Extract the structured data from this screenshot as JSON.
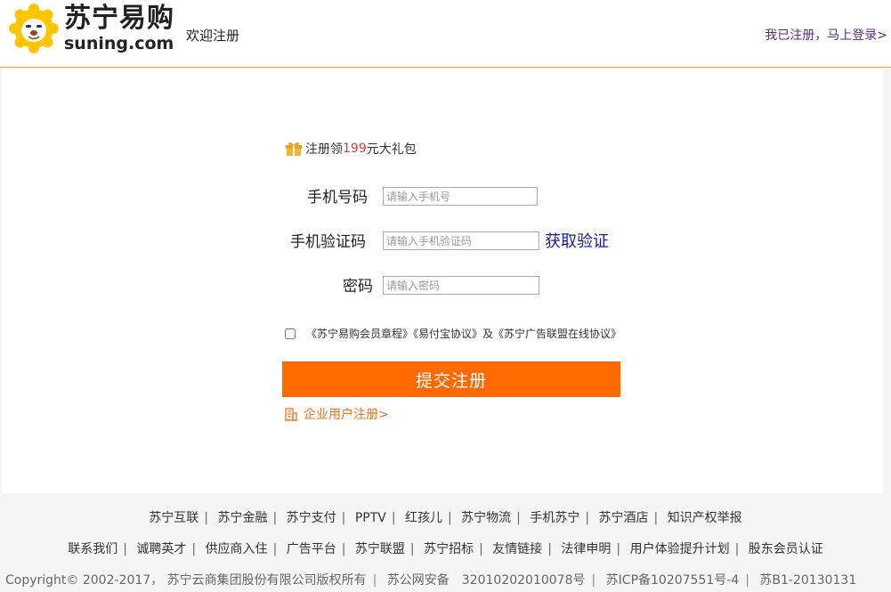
{
  "header": {
    "brand_cn": "苏宁易购",
    "brand_en": "suning.com",
    "welcome": "欢迎注册",
    "login_link": "我已注册，马上登录>"
  },
  "promo": {
    "prefix": "注册领 ",
    "amount": "199",
    "suffix": "元大礼包"
  },
  "form": {
    "phone_label": "手机号码",
    "phone_placeholder": "请输入手机号",
    "phone_value": "",
    "code_label": "手机验证码",
    "code_placeholder": "请输入手机验证码",
    "code_value": "",
    "get_code": "获取验证",
    "password_label": "密码",
    "password_placeholder": "请输入密码",
    "password_value": "",
    "agreement_checked": false,
    "agreement_text": "《苏宁易购会员章程》《易付宝协议》及《苏宁广告联盟在线协议》",
    "submit": "提交注册",
    "enterprise": "企业用户注册>"
  },
  "footer": {
    "row1": [
      "苏宁互联",
      "苏宁金融",
      "苏宁支付",
      "PPTV",
      "红孩儿",
      "苏宁物流",
      "手机苏宁",
      "苏宁酒店",
      "知识产权举报"
    ],
    "row2": [
      "联系我们",
      "诚聘英才",
      "供应商入住",
      "广告平台",
      "苏宁联盟",
      "苏宁招标",
      "友情链接",
      "法律申明",
      "用户体验提升计划",
      "股东会员认证"
    ],
    "copyright": "Copyright© 2002-2017， 苏宁云商集团股份有限公司版权所有",
    "police": "苏公网安备　32010202010078号",
    "icp": "苏ICP备10207551号-4",
    "b1": "苏B1-20130131"
  },
  "colors": {
    "accent_orange": "#ff6a00",
    "logo_yellow": "#ffc600",
    "promo_red": "#e4393c",
    "link_purple": "#5a2d82",
    "code_blue": "#1a1aa6"
  },
  "icons": [
    "suning-lion-logo",
    "gift-icon",
    "building-icon"
  ]
}
